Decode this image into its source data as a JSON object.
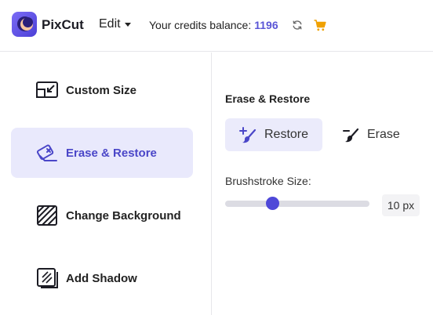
{
  "header": {
    "app_name": "PixCut",
    "edit_label": "Edit",
    "credits_label": "Your credits balance:",
    "credits_value": "1196",
    "icons": [
      "logo-icon",
      "refresh-icon",
      "cart-icon"
    ]
  },
  "sidebar": {
    "items": [
      {
        "label": "Custom Size",
        "icon": "resize-icon",
        "active": false
      },
      {
        "label": "Erase & Restore",
        "icon": "eraser-icon",
        "active": true
      },
      {
        "label": "Change Background",
        "icon": "background-pattern-icon",
        "active": false
      },
      {
        "label": "Add Shadow",
        "icon": "shadow-icon",
        "active": false
      }
    ]
  },
  "panel": {
    "title": "Erase & Restore",
    "restore_label": "Restore",
    "erase_label": "Erase",
    "selected_mode": "Restore",
    "brush_label": "Brushstroke Size:",
    "brush_value_text": "10 px",
    "brush_fraction": 0.33
  },
  "colors": {
    "accent": "#4e48d8",
    "active_bg": "#e9e9fc",
    "cart": "#f0a100"
  }
}
